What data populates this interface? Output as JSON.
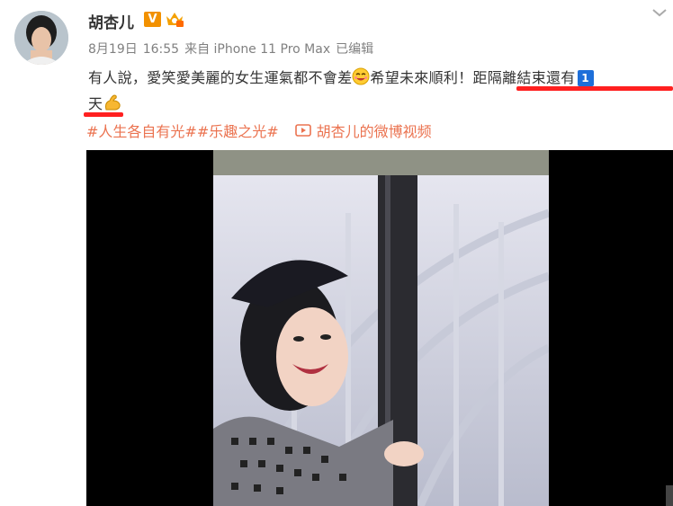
{
  "user": {
    "name": "胡杏儿",
    "verified_badge": "V"
  },
  "post": {
    "date": "8月19日",
    "time": "16:55",
    "source": "来自 iPhone 11 Pro Max",
    "edited": "已编辑",
    "text_part1": "有人說，愛笑愛美麗的女生運氣都不會差",
    "text_part2": "希望未來順利！距隔離結束還有",
    "countdown_number": "1",
    "text_part3": "天",
    "topics": [
      "#人生各自有光#",
      "#乐趣之光#"
    ],
    "video_link_label": "胡杏儿的微博视频"
  },
  "colors": {
    "topic": "#eb7350",
    "annotation": "#ff2020",
    "verified": "#f29100",
    "countdown_badge": "#1e6fd9"
  },
  "icons": [
    "vip-crown-icon",
    "chevron-down-icon",
    "smile-emoji-icon",
    "flexed-biceps-emoji-icon",
    "video-icon"
  ]
}
